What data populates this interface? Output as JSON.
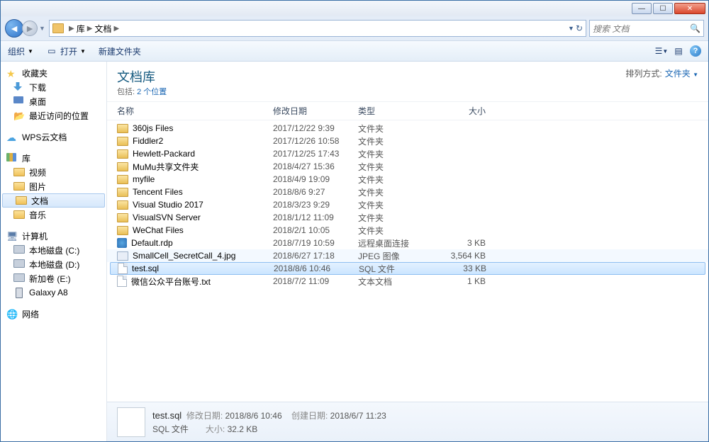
{
  "breadcrumb": {
    "root": "库",
    "current": "文档"
  },
  "search": {
    "placeholder": "搜索 文档"
  },
  "toolbar": {
    "organize": "组织",
    "open": "打开",
    "new_folder": "新建文件夹"
  },
  "library": {
    "title": "文档库",
    "includes_lbl": "包括:",
    "locations": "2 个位置",
    "arrange_lbl": "排列方式:",
    "arrange_val": "文件夹"
  },
  "columns": {
    "name": "名称",
    "date": "修改日期",
    "type": "类型",
    "size": "大小"
  },
  "sidebar": {
    "favorites": "收藏夹",
    "downloads": "下载",
    "desktop": "桌面",
    "recent": "最近访问的位置",
    "wps": "WPS云文档",
    "libraries": "库",
    "videos": "视频",
    "pictures": "图片",
    "documents": "文档",
    "music": "音乐",
    "computer": "计算机",
    "drive_c": "本地磁盘 (C:)",
    "drive_d": "本地磁盘 (D:)",
    "drive_e": "新加卷 (E:)",
    "galaxy": "Galaxy A8",
    "network": "网络"
  },
  "files": [
    {
      "name": "360js Files",
      "date": "2017/12/22 9:39",
      "type": "文件夹",
      "size": "",
      "icon": "folder"
    },
    {
      "name": "Fiddler2",
      "date": "2017/12/26 10:58",
      "type": "文件夹",
      "size": "",
      "icon": "folder"
    },
    {
      "name": "Hewlett-Packard",
      "date": "2017/12/25 17:43",
      "type": "文件夹",
      "size": "",
      "icon": "folder"
    },
    {
      "name": "MuMu共享文件夹",
      "date": "2018/4/27 15:36",
      "type": "文件夹",
      "size": "",
      "icon": "folder"
    },
    {
      "name": "myfile",
      "date": "2018/4/9 19:09",
      "type": "文件夹",
      "size": "",
      "icon": "folder"
    },
    {
      "name": "Tencent Files",
      "date": "2018/8/6 9:27",
      "type": "文件夹",
      "size": "",
      "icon": "folder"
    },
    {
      "name": "Visual Studio 2017",
      "date": "2018/3/23 9:29",
      "type": "文件夹",
      "size": "",
      "icon": "folder"
    },
    {
      "name": "VisualSVN Server",
      "date": "2018/1/12 11:09",
      "type": "文件夹",
      "size": "",
      "icon": "folder"
    },
    {
      "name": "WeChat Files",
      "date": "2018/2/1 10:05",
      "type": "文件夹",
      "size": "",
      "icon": "folder"
    },
    {
      "name": "Default.rdp",
      "date": "2018/7/19 10:59",
      "type": "远程桌面连接",
      "size": "3 KB",
      "icon": "rdp"
    },
    {
      "name": "SmallCell_SecretCall_4.jpg",
      "date": "2018/6/27 17:18",
      "type": "JPEG 图像",
      "size": "3,564 KB",
      "icon": "img"
    },
    {
      "name": "test.sql",
      "date": "2018/8/6 10:46",
      "type": "SQL 文件",
      "size": "33 KB",
      "icon": "file",
      "selected": true
    },
    {
      "name": "微信公众平台账号.txt",
      "date": "2018/7/2 11:09",
      "type": "文本文档",
      "size": "1 KB",
      "icon": "file"
    }
  ],
  "details": {
    "name": "test.sql",
    "type": "SQL 文件",
    "mod_lbl": "修改日期:",
    "mod_val": "2018/8/6 10:46",
    "size_lbl": "大小:",
    "size_val": "32.2 KB",
    "created_lbl": "创建日期:",
    "created_val": "2018/6/7 11:23"
  }
}
